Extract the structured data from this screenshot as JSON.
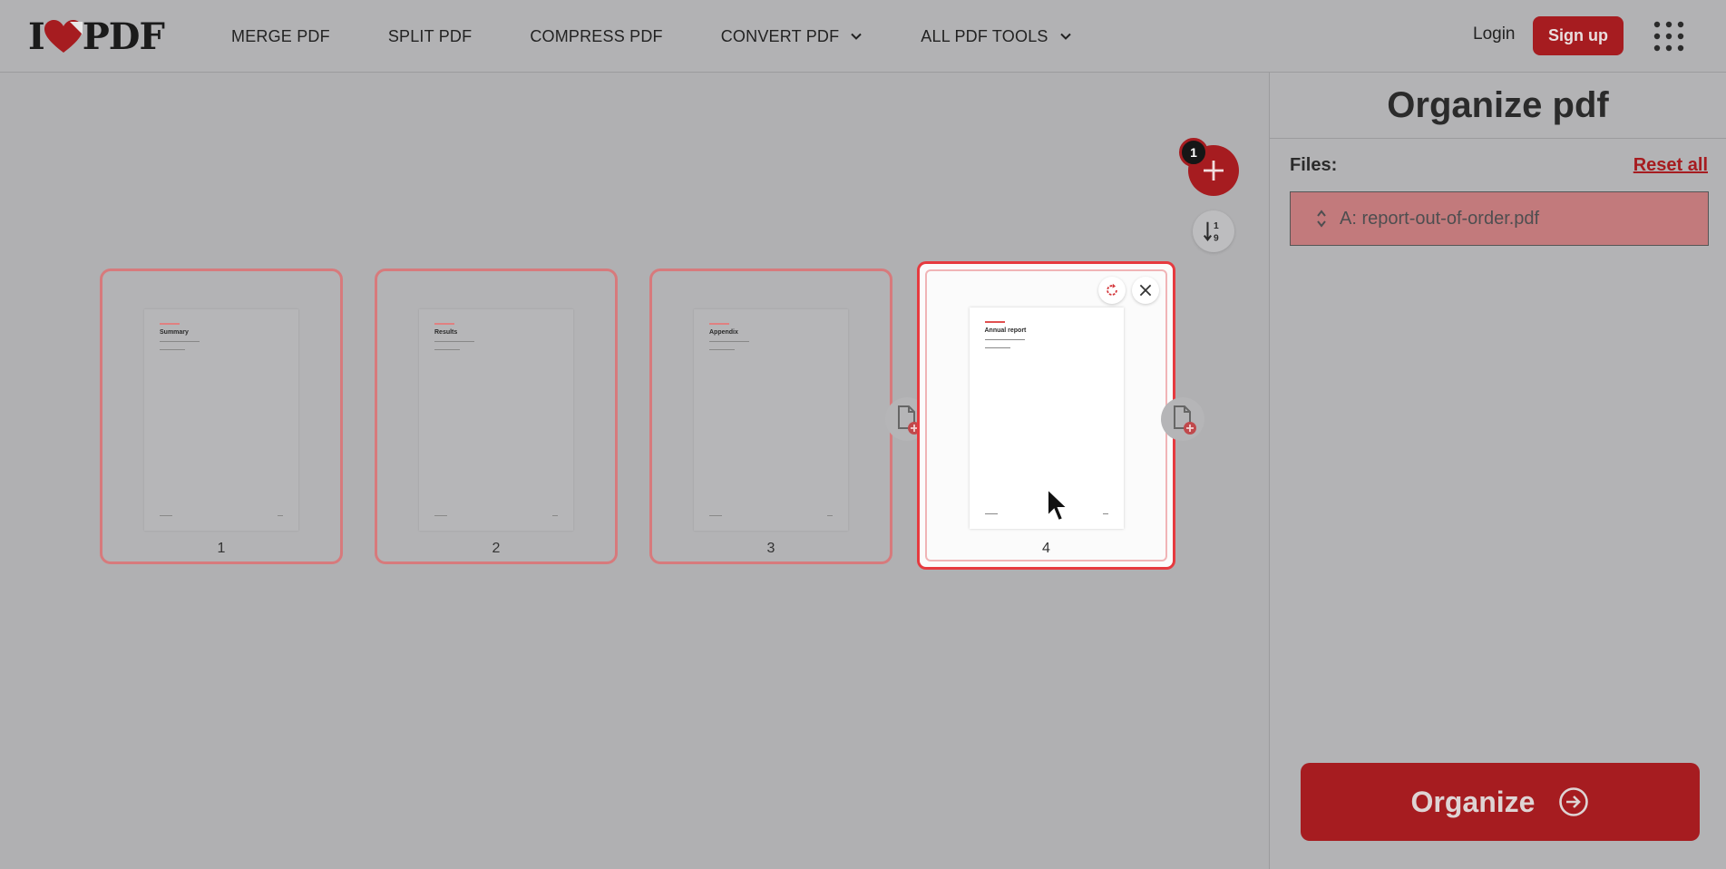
{
  "header": {
    "logo_left": "I",
    "logo_right": "PDF",
    "nav": [
      {
        "label": "MERGE PDF"
      },
      {
        "label": "SPLIT PDF"
      },
      {
        "label": "COMPRESS PDF"
      },
      {
        "label": "CONVERT PDF",
        "dropdown": true
      },
      {
        "label": "ALL PDF TOOLS",
        "dropdown": true
      }
    ],
    "login_label": "Login",
    "signup_label": "Sign up",
    "apps_icon": "grid-icon"
  },
  "workspace": {
    "file_count_badge": "1",
    "add_icon": "plus-icon",
    "sort_icon": "sort-ascending-icon",
    "pages": [
      {
        "number": "1",
        "title": "Summary",
        "selected": false
      },
      {
        "number": "2",
        "title": "Results",
        "selected": false
      },
      {
        "number": "3",
        "title": "Appendix",
        "selected": false
      },
      {
        "number": "4",
        "title": "Annual report",
        "selected": true
      }
    ]
  },
  "sidebar": {
    "title": "Organize pdf",
    "files_label": "Files:",
    "reset_label": "Reset all",
    "files": [
      {
        "name": "A: report-out-of-order.pdf"
      }
    ],
    "organize_label": "Organize"
  },
  "colors": {
    "brand_red": "#a61c20",
    "selected_border": "#e63a3f",
    "overlay_gray": "#b0b0b2"
  }
}
